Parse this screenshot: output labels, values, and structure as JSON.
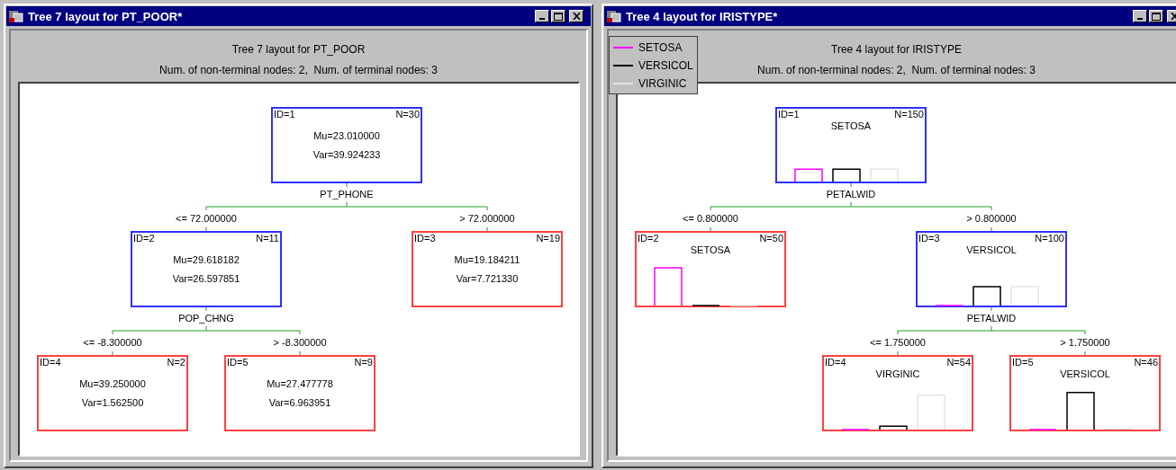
{
  "windows": [
    {
      "title": "Tree 7 layout for PT_POOR*",
      "heading": "Tree 7 layout for PT_POOR",
      "summary": "Num. of non-terminal nodes: 2,  Num. of terminal nodes: 3",
      "tree": {
        "kind": "regression",
        "terminal": false,
        "id_label": "ID=1",
        "n_label": "N=30",
        "lines": [
          "Mu=23.010000",
          "Var=39.924233"
        ],
        "split": "PT_PHONE",
        "children": [
          {
            "condition": "<= 72.000000",
            "kind": "regression",
            "terminal": false,
            "id_label": "ID=2",
            "n_label": "N=11",
            "lines": [
              "Mu=29.618182",
              "Var=26.597851"
            ],
            "split": "POP_CHNG",
            "children": [
              {
                "condition": "<= -8.300000",
                "kind": "regression",
                "terminal": true,
                "id_label": "ID=4",
                "n_label": "N=2",
                "lines": [
                  "Mu=39.250000",
                  "Var=1.562500"
                ]
              },
              {
                "condition": "> -8.300000",
                "kind": "regression",
                "terminal": true,
                "id_label": "ID=5",
                "n_label": "N=9",
                "lines": [
                  "Mu=27.477778",
                  "Var=6.963951"
                ]
              }
            ]
          },
          {
            "condition": "> 72.000000",
            "kind": "regression",
            "terminal": true,
            "id_label": "ID=3",
            "n_label": "N=19",
            "lines": [
              "Mu=19.184211",
              "Var=7.721330"
            ]
          }
        ]
      }
    },
    {
      "title": "Tree 4 layout for IRISTYPE*",
      "heading": "Tree 4 layout for IRISTYPE",
      "summary": "Num. of non-terminal nodes: 2,  Num. of terminal nodes: 3",
      "legend": [
        {
          "label": "SETOSA",
          "color": "#ff00ff"
        },
        {
          "label": "VERSICOL",
          "color": "#000000"
        },
        {
          "label": "VIRGINIC",
          "color": "#e4e4e4"
        }
      ],
      "tree": {
        "kind": "classification",
        "terminal": false,
        "id_label": "ID=1",
        "n_label": "N=150",
        "class": "SETOSA",
        "split": "PETALWID",
        "children": [
          {
            "condition": "<= 0.800000",
            "kind": "classification",
            "terminal": true,
            "id_label": "ID=2",
            "n_label": "N=50",
            "class": "SETOSA"
          },
          {
            "condition": "> 0.800000",
            "kind": "classification",
            "terminal": false,
            "id_label": "ID=3",
            "n_label": "N=100",
            "class": "VERSICOL",
            "split": "PETALWID",
            "children": [
              {
                "condition": "<= 1.750000",
                "kind": "classification",
                "terminal": true,
                "id_label": "ID=4",
                "n_label": "N=54",
                "class": "VIRGINIC"
              },
              {
                "condition": "> 1.750000",
                "kind": "classification",
                "terminal": true,
                "id_label": "ID=5",
                "n_label": "N=46",
                "class": "VERSICOL"
              }
            ]
          }
        ]
      }
    }
  ]
}
